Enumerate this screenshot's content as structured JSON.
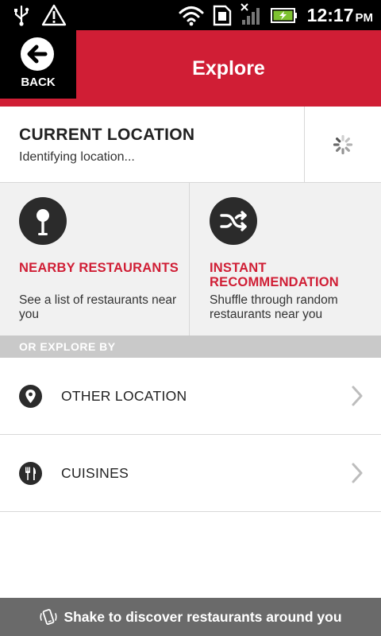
{
  "status_bar": {
    "time": "12:17",
    "ampm": "PM",
    "icons": [
      "usb-icon",
      "warning-icon",
      "wifi-icon",
      "sim-icon",
      "signal-icon",
      "battery-charging-icon"
    ]
  },
  "header": {
    "back_label": "BACK",
    "title": "Explore",
    "accent_color": "#d01e35"
  },
  "current_location": {
    "title": "CURRENT LOCATION",
    "status": "Identifying location..."
  },
  "options": [
    {
      "title": "NEARBY RESTAURANTS",
      "description": "See a list of restaurants near you",
      "icon": "map-pin-icon"
    },
    {
      "title": "INSTANT RECOMMENDATION",
      "description": "Shuffle through random restaurants near you",
      "icon": "shuffle-icon"
    }
  ],
  "explore_by": {
    "label": "OR EXPLORE BY",
    "items": [
      {
        "label": "OTHER LOCATION",
        "icon": "location-pin-icon"
      },
      {
        "label": "CUISINES",
        "icon": "fork-knife-icon"
      }
    ]
  },
  "footer": {
    "text": "Shake to discover restaurants around you",
    "icon": "shake-phone-icon"
  }
}
